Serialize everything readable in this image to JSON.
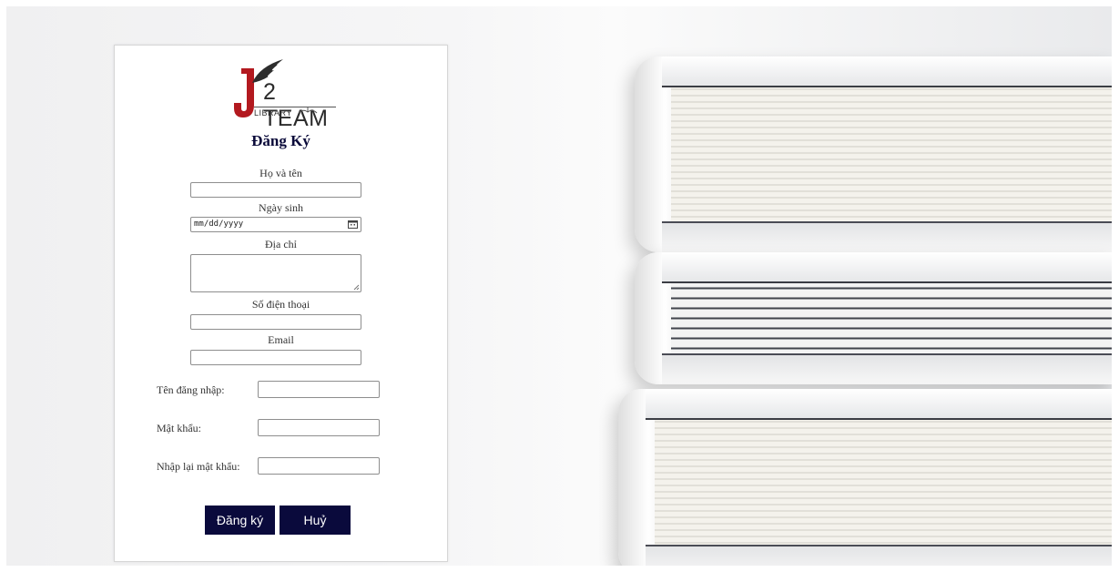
{
  "logo": {
    "text": "2 TEAM",
    "sub": "LIBRARY",
    "mark": "J"
  },
  "form": {
    "title": "Đăng Ký",
    "fullname_label": "Họ và tên",
    "birthday_label": "Ngày sinh",
    "birthday_placeholder": "mm/dd/yyyy",
    "address_label": "Địa chỉ",
    "phone_label": "Số điện thoại",
    "email_label": "Email",
    "username_label": "Tên đăng nhập:",
    "password_label": "Mật khẩu:",
    "confirm_label": "Nhập lại mật khẩu:",
    "submit_label": "Đăng ký",
    "cancel_label": "Huỷ"
  },
  "colors": {
    "button_bg": "#0a0a3c",
    "title": "#0b0b3a",
    "logo_red": "#b3191f"
  }
}
